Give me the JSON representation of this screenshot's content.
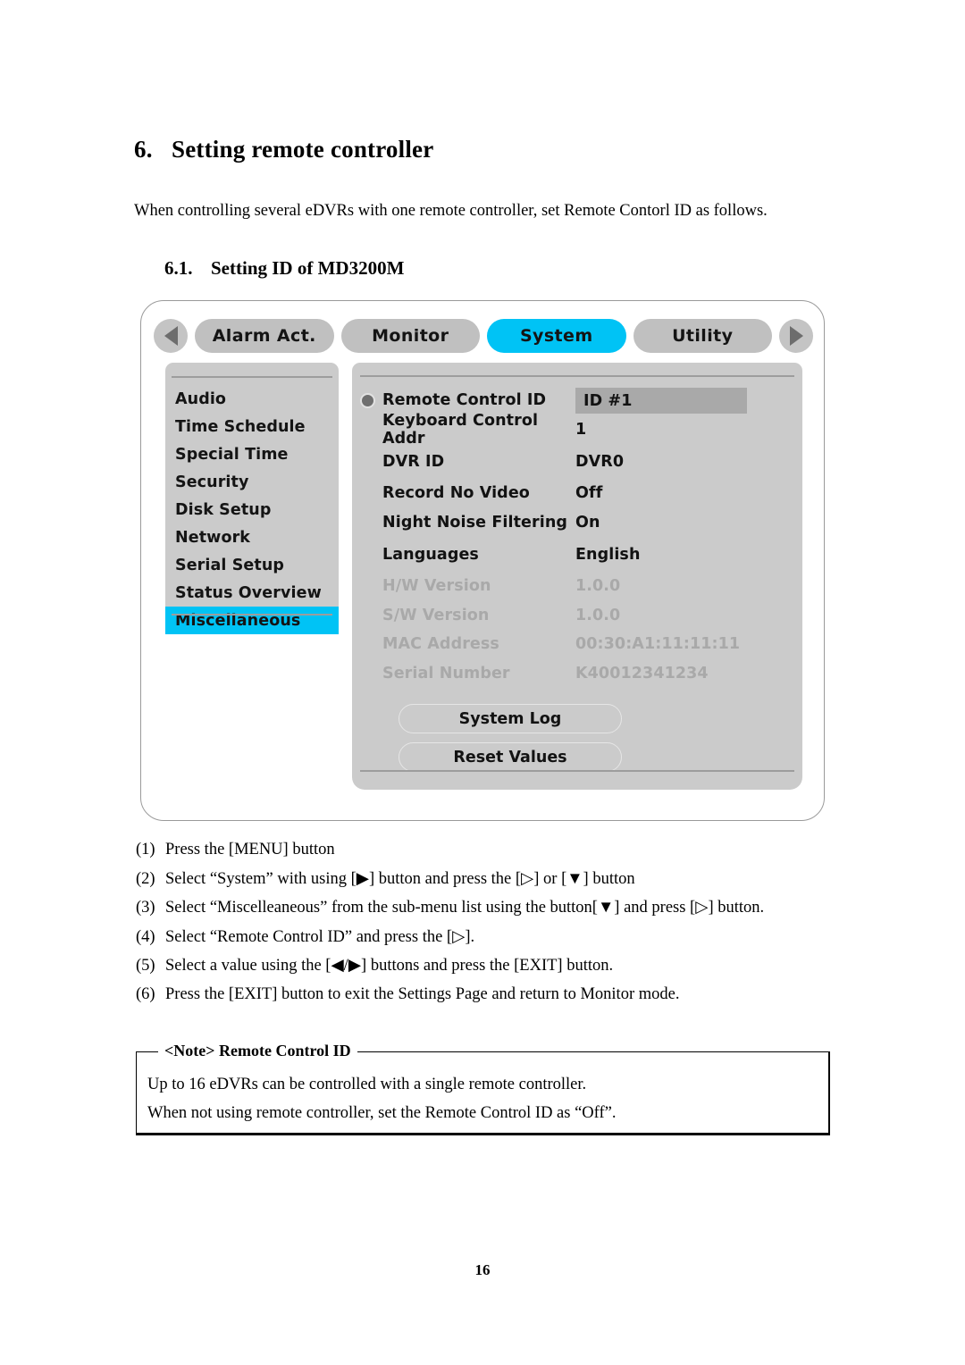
{
  "document": {
    "section_number": "6.",
    "section_title": "Setting remote controller",
    "intro": "When controlling several eDVRs with one remote controller, set Remote Contorl ID as follows.",
    "subsection_number": "6.1.",
    "subsection_title": "Setting ID of MD3200M",
    "page_number": "16"
  },
  "dvr": {
    "nav": {
      "prev_icon": "left-triangle-icon",
      "next_icon": "right-triangle-icon"
    },
    "tabs": [
      {
        "label": "Alarm Act.",
        "active": false
      },
      {
        "label": "Monitor",
        "active": false
      },
      {
        "label": "System",
        "active": true
      },
      {
        "label": "Utility",
        "active": false
      }
    ],
    "sidebar": {
      "items": [
        {
          "label": "Audio",
          "selected": false
        },
        {
          "label": "Time Schedule",
          "selected": false
        },
        {
          "label": "Special Time",
          "selected": false
        },
        {
          "label": "Security",
          "selected": false
        },
        {
          "label": "Disk Setup",
          "selected": false
        },
        {
          "label": "Network",
          "selected": false
        },
        {
          "label": "Serial Setup",
          "selected": false
        },
        {
          "label": "Status Overview",
          "selected": false
        },
        {
          "label": "Miscellaneous",
          "selected": true
        }
      ]
    },
    "settings": [
      {
        "label": "Remote Control ID",
        "value": "ID #1",
        "bullet": true,
        "highlighted": true,
        "disabled": false
      },
      {
        "label": "Keyboard Control Addr",
        "value": "1",
        "bullet": false,
        "highlighted": false,
        "disabled": false
      },
      {
        "label": "DVR ID",
        "value": "DVR0",
        "bullet": false,
        "highlighted": false,
        "disabled": false
      },
      {
        "label": "Record No Video",
        "value": "Off",
        "bullet": false,
        "highlighted": false,
        "disabled": false
      },
      {
        "label": "Night Noise Filtering",
        "value": "On",
        "bullet": false,
        "highlighted": false,
        "disabled": false
      },
      {
        "label": "Languages",
        "value": "English",
        "bullet": false,
        "highlighted": false,
        "disabled": false
      },
      {
        "label": "H/W Version",
        "value": "1.0.0",
        "bullet": false,
        "highlighted": false,
        "disabled": true
      },
      {
        "label": "S/W Version",
        "value": "1.0.0",
        "bullet": false,
        "highlighted": false,
        "disabled": true
      },
      {
        "label": "MAC Address",
        "value": "00:30:A1:11:11:11",
        "bullet": false,
        "highlighted": false,
        "disabled": true
      },
      {
        "label": "Serial Number",
        "value": "K40012341234",
        "bullet": false,
        "highlighted": false,
        "disabled": true
      }
    ],
    "buttons": [
      {
        "label": "System Log"
      },
      {
        "label": "Reset Values"
      }
    ],
    "colors": {
      "accent": "#00c3f5",
      "panel": "#cbcbcb",
      "tab": "#c0c0c0",
      "highlight_box": "#a9a9a9",
      "disabled_text": "#a9a9a9"
    }
  },
  "steps": [
    {
      "num": "(1)",
      "text": "Press the [MENU] button"
    },
    {
      "num": "(2)",
      "text": "Select “System” with using   [▶] button and press the [▷] or [▼] button"
    },
    {
      "num": "(3)",
      "text": "Select “Miscelleaneous” from the sub-menu list using   the button[▼]   and press [▷] button."
    },
    {
      "num": "(4)",
      "text": "Select “Remote Control ID” and press the [▷]."
    },
    {
      "num": "(5)",
      "text": "Select a value using the [◀/▶] buttons and press the [EXIT] button."
    },
    {
      "num": "(6)",
      "text": "Press the [EXIT] button to exit the Settings Page and return to Monitor mode."
    }
  ],
  "note": {
    "legend": "<Note> Remote Control ID",
    "lines": [
      "Up to 16 eDVRs can be controlled with a single remote controller.",
      "When not using remote controller, set the Remote Control ID as “Off”."
    ]
  }
}
